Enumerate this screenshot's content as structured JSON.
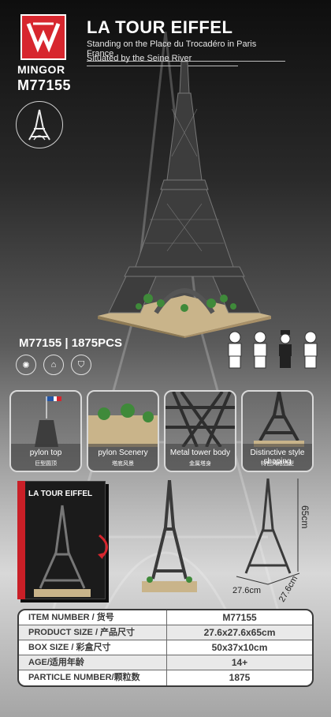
{
  "header": {
    "brand": "MINGOR",
    "model": "M77155",
    "title": "LA TOUR EIFFEL",
    "subtitle1": "Standing on the Place du Trocadéro in Paris France",
    "subtitle2": "Situated by the Seine River"
  },
  "spec_line": "M77155 | 1875PCS",
  "thumbnails": [
    {
      "label": "pylon top",
      "label_cn": "巨型圆顶"
    },
    {
      "label": "pylon Scenery",
      "label_cn": "塔底风景"
    },
    {
      "label": "Metal tower body",
      "label_cn": "金属塔身"
    },
    {
      "label": "Distinctive style shaping",
      "label_cn": "特色风格造型"
    }
  ],
  "box": {
    "title": "LA TOUR EIFFEL"
  },
  "dimensions": {
    "height": "65cm",
    "width": "27.6cm",
    "depth": "27.6cm"
  },
  "specs": [
    {
      "key": "ITEM NUMBER / 货号",
      "value": "M77155"
    },
    {
      "key": "PRODUCT SIZE / 产品尺寸",
      "value": "27.6x27.6x65cm"
    },
    {
      "key": "BOX SIZE / 彩盒尺寸",
      "value": "50x37x10cm"
    },
    {
      "key": "AGE/适用年龄",
      "value": "14+"
    },
    {
      "key": "PARTICLE NUMBER/颗粒数",
      "value": "1875"
    }
  ],
  "colors": {
    "brand_red": "#d7262e",
    "tower_gray": "#4a4a4a",
    "base_tan": "#c9b48a"
  }
}
